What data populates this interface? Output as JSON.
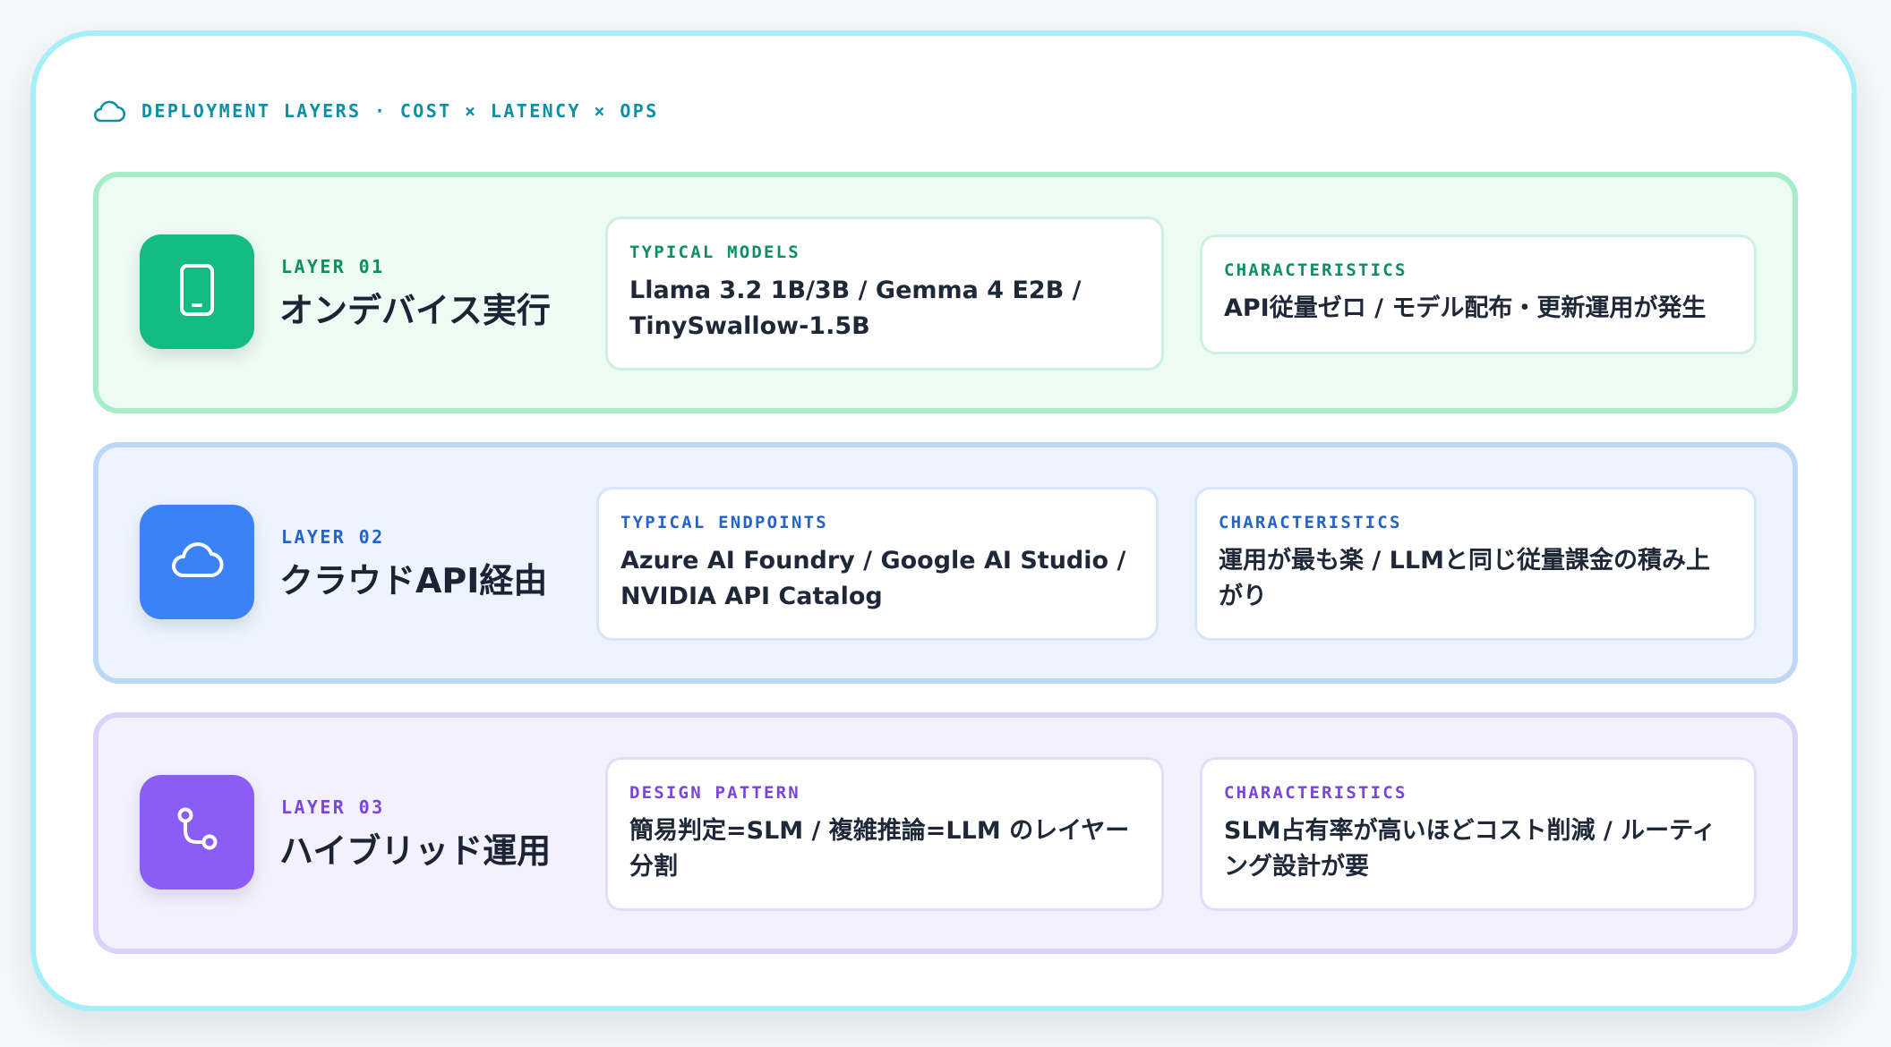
{
  "header": {
    "icon": "cloud-icon",
    "text": "DEPLOYMENT LAYERS · COST × LATENCY × OPS",
    "color": "#0f8fa6"
  },
  "layers": [
    {
      "number": "LAYER 01",
      "title": "オンデバイス実行",
      "icon": "tablet-icon",
      "accent": "#14bb83",
      "boxes": [
        {
          "label": "TYPICAL MODELS",
          "text": "Llama 3.2 1B/3B / Gemma 4 E2B / TinySwallow-1.5B"
        },
        {
          "label": "CHARACTERISTICS",
          "text": "API従量ゼロ / モデル配布・更新運用が発生"
        }
      ]
    },
    {
      "number": "LAYER 02",
      "title": "クラウドAPI経由",
      "icon": "cloud-icon",
      "accent": "#3b82f6",
      "boxes": [
        {
          "label": "TYPICAL ENDPOINTS",
          "text": "Azure AI Foundry / Google AI Studio / NVIDIA API Catalog"
        },
        {
          "label": "CHARACTERISTICS",
          "text": "運用が最も楽 / LLMと同じ従量課金の積み上がり"
        }
      ]
    },
    {
      "number": "LAYER 03",
      "title": "ハイブリッド運用",
      "icon": "git-branch-icon",
      "accent": "#8b5cf6",
      "boxes": [
        {
          "label": "DESIGN PATTERN",
          "text": "簡易判定=SLM / 複雑推論=LLM のレイヤー分割"
        },
        {
          "label": "CHARACTERISTICS",
          "text": "SLM占有率が高いほどコスト削減 / ルーティング設計が要"
        }
      ]
    }
  ]
}
